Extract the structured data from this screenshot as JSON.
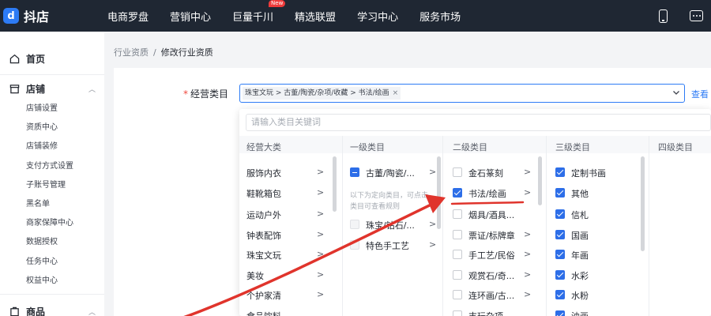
{
  "topbar": {
    "logo_mark": "d",
    "logo_text": "抖店",
    "nav": [
      "电商罗盘",
      "营销中心",
      "巨量千川",
      "精选联盟",
      "学习中心",
      "服务市场"
    ],
    "new_badge": "New"
  },
  "sidebar": {
    "home": "首页",
    "store": "店铺",
    "store_items": [
      "店铺设置",
      "资质中心",
      "店铺装修",
      "支付方式设置",
      "子账号管理",
      "黑名单",
      "商家保障中心",
      "数据授权",
      "任务中心",
      "权益中心"
    ],
    "goods": "商品"
  },
  "breadcrumb": {
    "parent": "行业资质",
    "sep": "/",
    "current": "修改行业资质"
  },
  "form": {
    "required_mark": "*",
    "label": "经营类目",
    "tag": "珠宝文玩 > 古董/陶瓷/杂项/收藏 > 书法/绘画",
    "tag_close": "×",
    "view_link": "查看"
  },
  "dropdown": {
    "search_placeholder": "请输入类目关键词",
    "headers": [
      "经营大类",
      "一级类目",
      "二级类目",
      "三级类目",
      "四级类目"
    ],
    "col1": [
      "服饰内衣",
      "鞋靴箱包",
      "运动户外",
      "钟表配饰",
      "珠宝文玩",
      "美妆",
      "个护家清",
      "食品饮料"
    ],
    "col2": {
      "selected": "古董/陶瓷/...",
      "hint_line1": "以下为定向类目，可点击",
      "hint_line2": "类目可查看规则",
      "items": [
        "珠宝/钻石/...",
        "特色手工艺"
      ]
    },
    "col3": [
      "金石篆刻",
      "书法/绘画",
      "烟具/酒具...",
      "票证/标牌章",
      "手工艺/民俗",
      "观赏石/奇...",
      "连环画/古...",
      "支玩杂项"
    ],
    "col4": [
      "定制书画",
      "其他",
      "信札",
      "国画",
      "年画",
      "水彩",
      "水粉",
      "油画"
    ],
    "arrow": ">"
  }
}
